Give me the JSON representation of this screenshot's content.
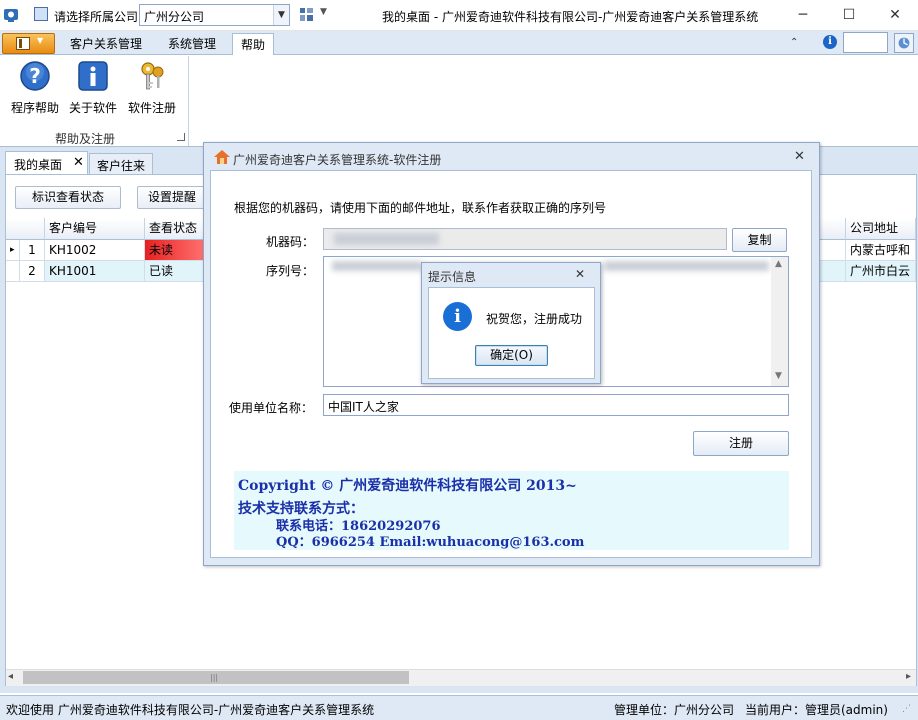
{
  "titlebar": {
    "company_label": "请选择所属公司",
    "company_value": "广州分公司",
    "window_title": "我的桌面 - 广州爱奇迪软件科技有限公司-广州爱奇迪客户关系管理系统",
    "minimize": "─",
    "maximize": "☐",
    "close": "✕"
  },
  "ribbon": {
    "tabs": [
      {
        "label": "客户关系管理"
      },
      {
        "label": "系统管理"
      },
      {
        "label": "帮助"
      }
    ],
    "group_title": "帮助及注册",
    "buttons": [
      {
        "label": "程序帮助",
        "icon": "help-icon"
      },
      {
        "label": "关于软件",
        "icon": "info-icon"
      },
      {
        "label": "软件注册",
        "icon": "keys-icon"
      }
    ]
  },
  "doc_tabs": [
    {
      "label": "我的桌面",
      "close": "✕"
    },
    {
      "label": "客户往来"
    }
  ],
  "toolbar": {
    "mark_status": "标识查看状态",
    "set_reminder": "设置提醒"
  },
  "grid": {
    "columns": [
      "客户编号",
      "查看状态",
      "公司地址"
    ],
    "rows": [
      {
        "n": "1",
        "id": "KH1002",
        "status": "未读",
        "address": "内蒙古呼和"
      },
      {
        "n": "2",
        "id": "KH1001",
        "status": "已读",
        "address": "广州市白云"
      }
    ],
    "current_marker": "▸"
  },
  "status_bar": {
    "welcome": "欢迎使用 广州爱奇迪软件科技有限公司-广州爱奇迪客户关系管理系统",
    "unit": "管理单位：广州分公司",
    "user": "当前用户：管理员(admin)"
  },
  "register_dialog": {
    "title": "广州爱奇迪客户关系管理系统-软件注册",
    "close": "✕",
    "instruction": "根据您的机器码，请使用下面的邮件地址，联系作者获取正确的序列号",
    "machine_label": "机器码：",
    "copy_button": "复制",
    "serial_label": "序列号：",
    "unit_label": "使用单位名称：",
    "unit_value": "中国IT人之家",
    "register_button": "注册",
    "copyright": {
      "line1": "Copyright © 广州爱奇迪软件科技有限公司 2013~",
      "line2": "技术支持联系方式：",
      "line3": "联系电话：18620292076",
      "line4": "QQ：6966254   Email:wuhuacong@163.com"
    }
  },
  "message_box": {
    "title": "提示信息",
    "close": "✕",
    "text": "祝贺您，注册成功",
    "ok_button": "确定(O)",
    "icon_glyph": "i"
  },
  "colors": {
    "unread": "#e83a3a",
    "accent": "#1d64c7",
    "copyright_text": "#1a2fa8"
  }
}
